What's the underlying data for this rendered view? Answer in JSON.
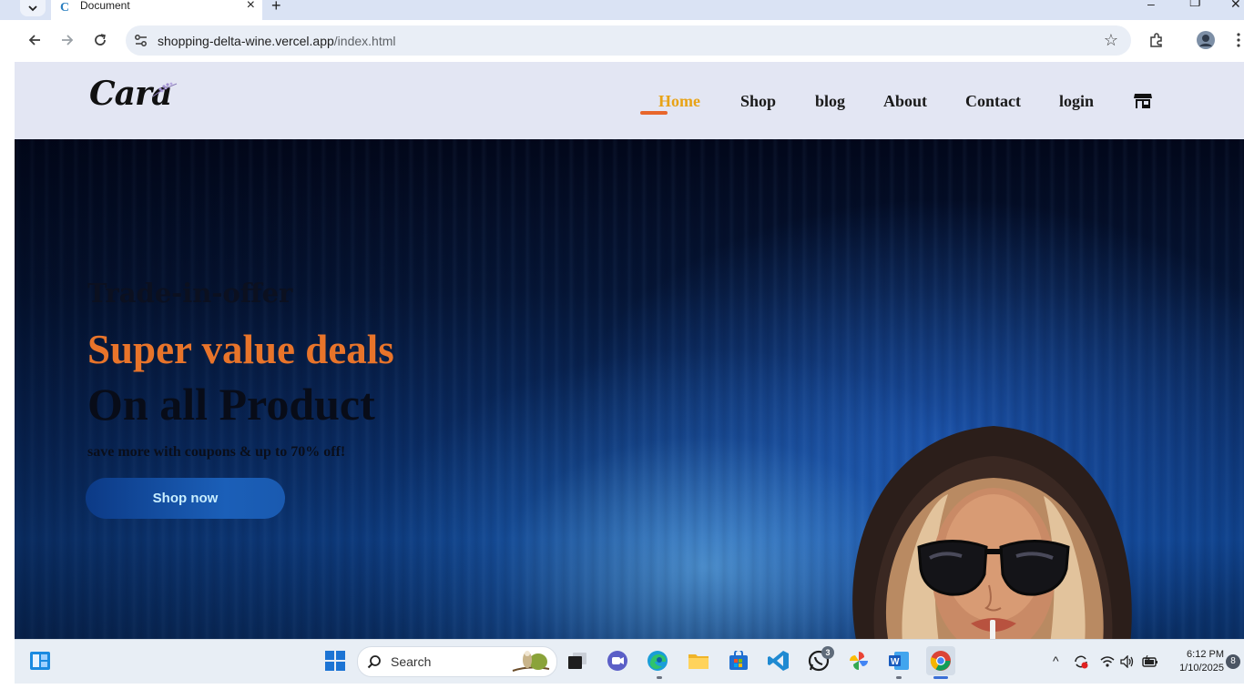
{
  "browser": {
    "tab_title": "Document",
    "tab_favicon": "C",
    "url_host": "shopping-delta-wine.vercel.app",
    "url_path": "/index.html"
  },
  "site": {
    "logo_text": "Cara",
    "nav": [
      {
        "label": "Home",
        "active": true
      },
      {
        "label": "Shop"
      },
      {
        "label": "blog"
      },
      {
        "label": "About"
      },
      {
        "label": "Contact"
      },
      {
        "label": "login"
      }
    ],
    "cart_icon": "store-icon"
  },
  "hero": {
    "eyebrow": "Trade-in-offer",
    "headline_accent": "Super value deals",
    "headline": "On all Product",
    "subtext": "save more with coupons & up to 70% off!",
    "cta_label": "Shop now"
  },
  "taskbar": {
    "search_placeholder": "Search",
    "whatsapp_badge": "3",
    "time": "6:12 PM",
    "date": "1/10/2025",
    "notification_count": "8"
  },
  "colors": {
    "accent_orange": "#e8742a",
    "active_nav": "#e8a317",
    "header_bg": "#e3e6f3"
  }
}
